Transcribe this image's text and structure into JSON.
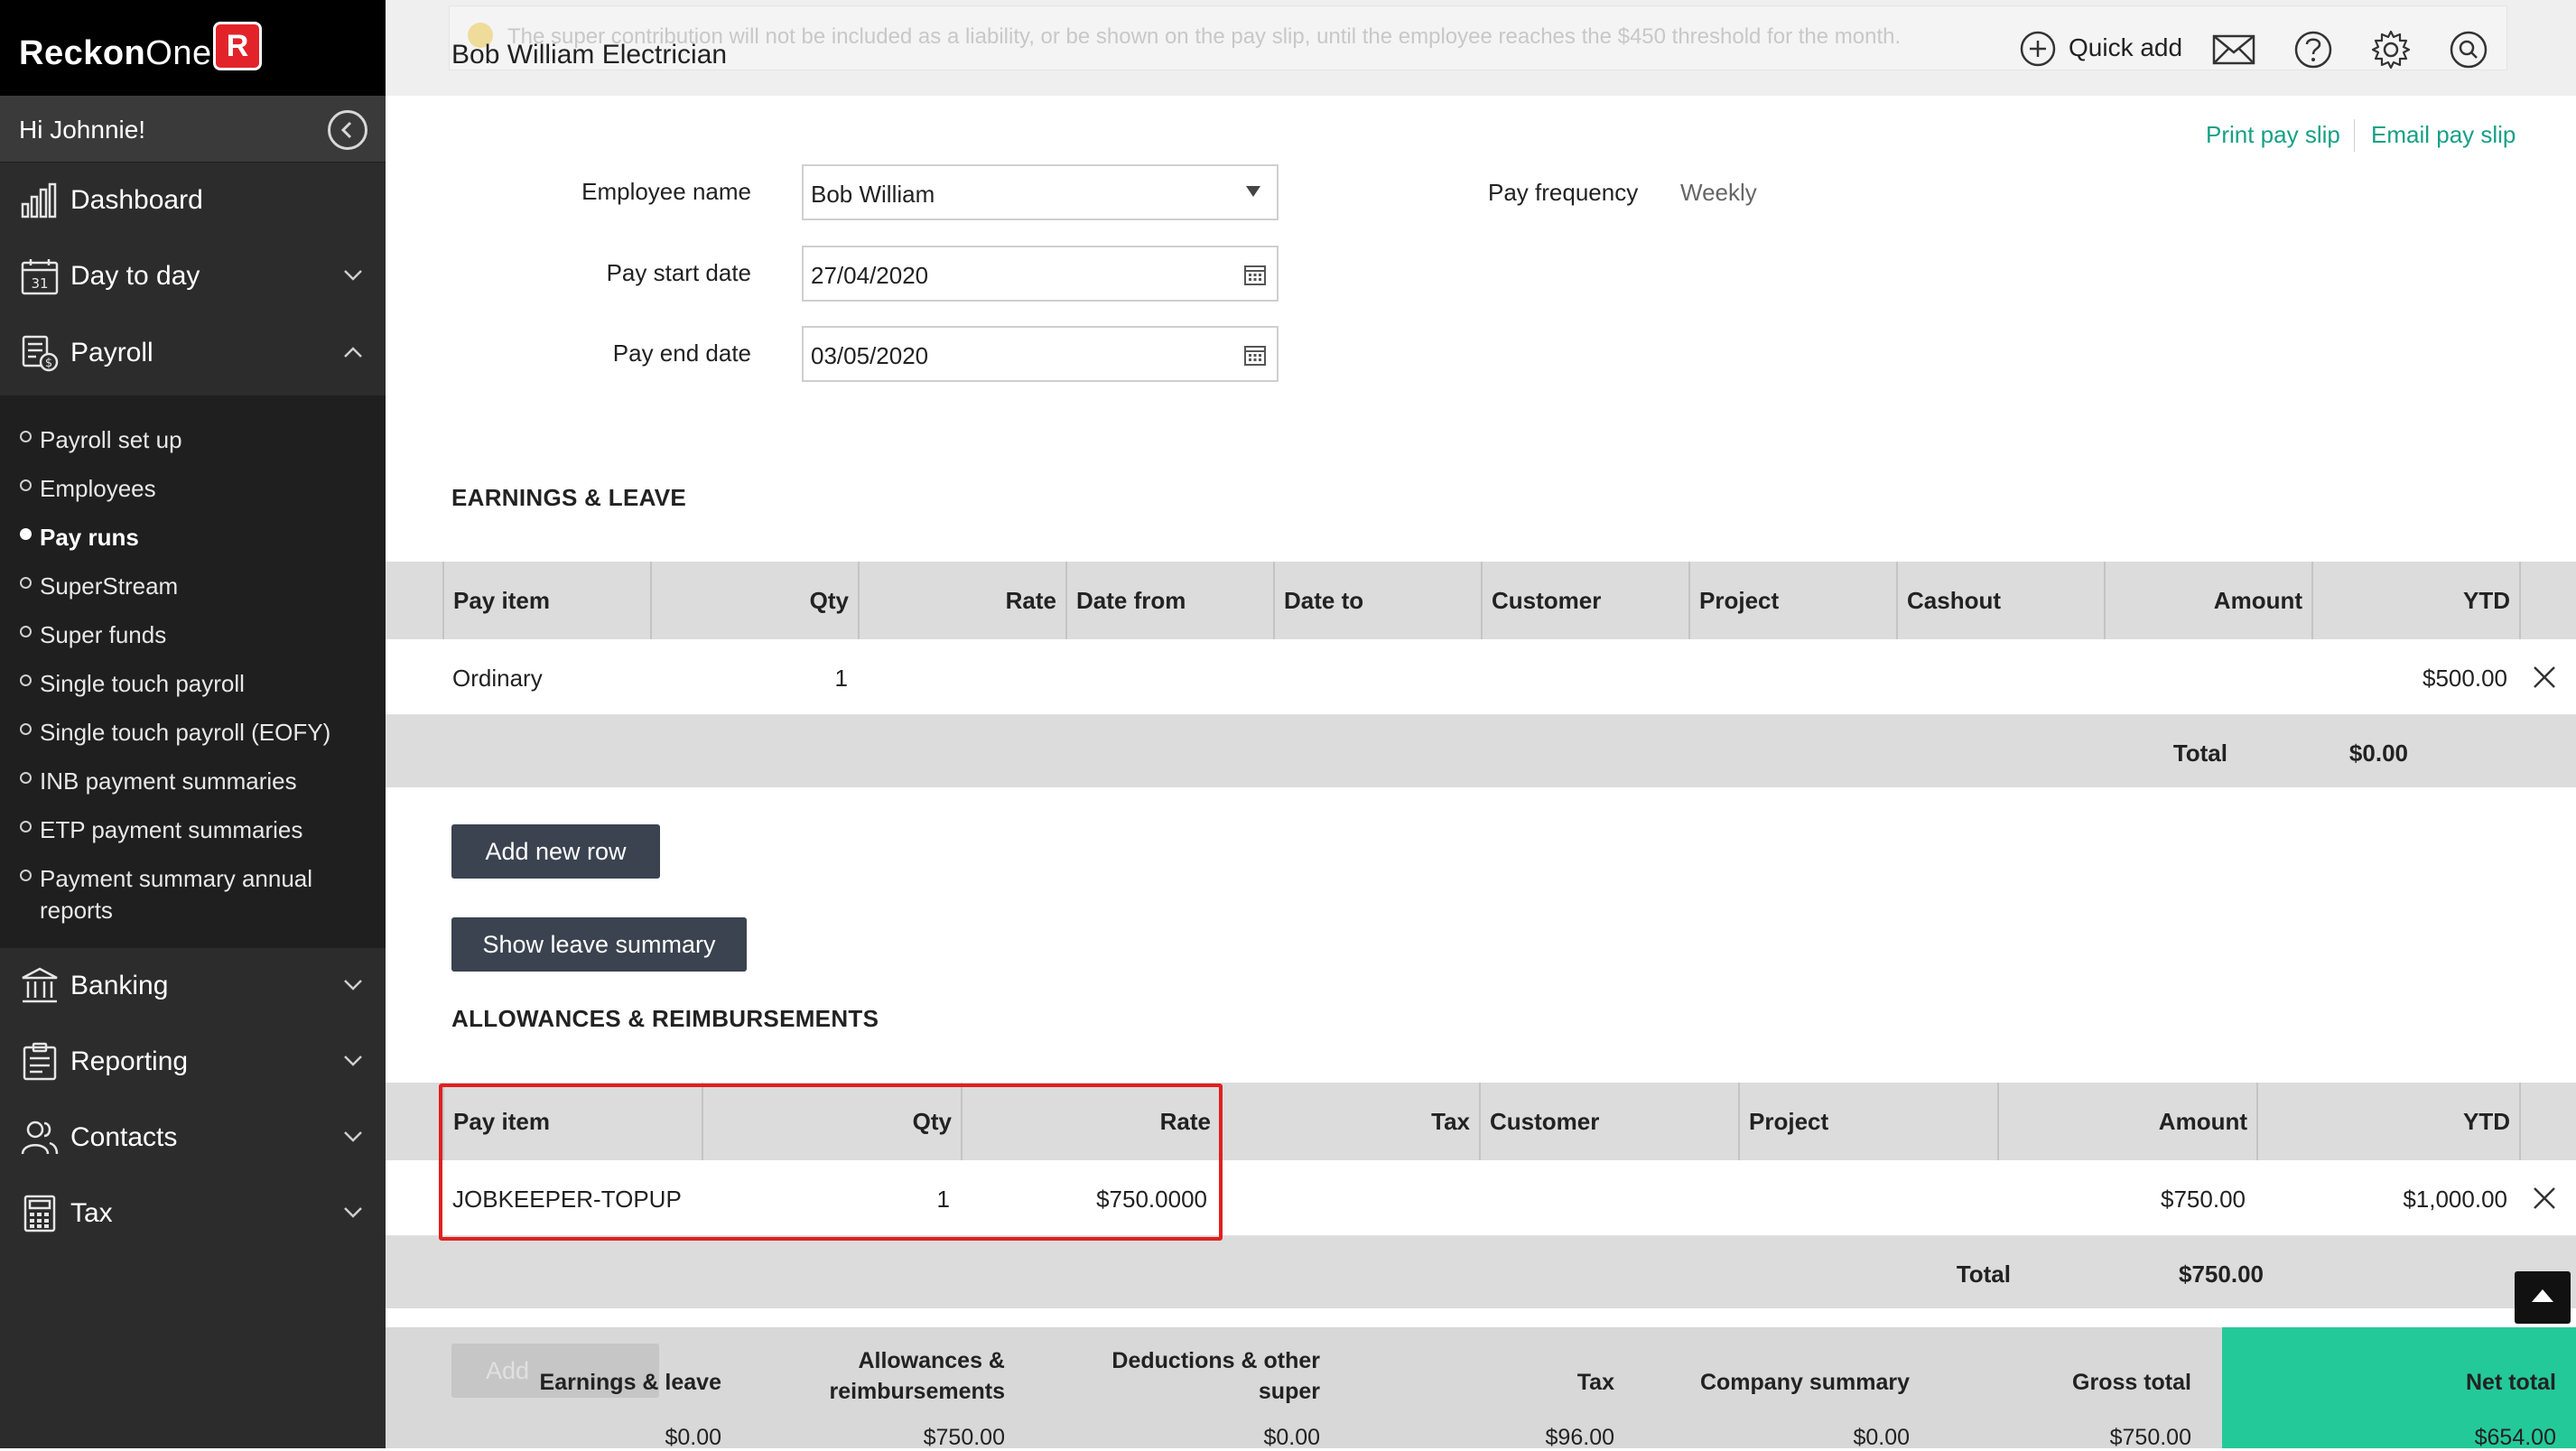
{
  "app": {
    "logo_text": "ReckonOne",
    "logo_badge": "R"
  },
  "sidebar": {
    "greeting": "Hi Johnnie!",
    "items": [
      {
        "label": "Dashboard",
        "icon": "bar-chart-icon"
      },
      {
        "label": "Day to day",
        "icon": "calendar-icon"
      },
      {
        "label": "Payroll",
        "icon": "payroll-icon"
      },
      {
        "label": "Banking",
        "icon": "bank-icon"
      },
      {
        "label": "Reporting",
        "icon": "report-icon"
      },
      {
        "label": "Contacts",
        "icon": "contacts-icon"
      },
      {
        "label": "Tax",
        "icon": "calculator-icon"
      }
    ],
    "payroll_sub": [
      {
        "label": "Payroll set up",
        "active": false
      },
      {
        "label": "Employees",
        "active": false
      },
      {
        "label": "Pay runs",
        "active": true
      },
      {
        "label": "SuperStream",
        "active": false
      },
      {
        "label": "Super funds",
        "active": false
      },
      {
        "label": "Single touch payroll",
        "active": false
      },
      {
        "label": "Single touch payroll (EOFY)",
        "active": false
      },
      {
        "label": "INB payment summaries",
        "active": false
      },
      {
        "label": "ETP payment summaries",
        "active": false
      },
      {
        "label": "Payment summary annual reports",
        "active": false
      }
    ]
  },
  "header": {
    "notice": "The super contribution will not be included as a liability, or be shown on the pay slip, until the employee reaches the $450 threshold for the month.",
    "title": "Bob William Electrician",
    "quick_add": "Quick add"
  },
  "actions": {
    "print": "Print pay slip",
    "email": "Email pay slip"
  },
  "form": {
    "employee_label": "Employee name",
    "employee_value": "Bob William",
    "start_label": "Pay start date",
    "start_value": "27/04/2020",
    "end_label": "Pay end date",
    "end_value": "03/05/2020",
    "frequency_label": "Pay frequency",
    "frequency_value": "Weekly"
  },
  "earnings": {
    "heading": "EARNINGS & LEAVE",
    "headers": [
      "Pay item",
      "Qty",
      "Rate",
      "Date from",
      "Date to",
      "Customer",
      "Project",
      "Cashout",
      "Amount",
      "YTD"
    ],
    "rows": [
      {
        "pay_item": "Ordinary",
        "qty": "1",
        "ytd": "$500.00"
      }
    ],
    "total_label": "Total",
    "total_value": "$0.00",
    "add_row": "Add new row",
    "leave_summary": "Show leave summary"
  },
  "allowances": {
    "heading": "ALLOWANCES & REIMBURSEMENTS",
    "headers": [
      "Pay item",
      "Qty",
      "Rate",
      "Tax",
      "Customer",
      "Project",
      "Amount",
      "YTD"
    ],
    "rows": [
      {
        "pay_item": "JOBKEEPER-TOPUP",
        "qty": "1",
        "rate": "$750.0000",
        "amount": "$750.00",
        "ytd": "$1,000.00"
      }
    ],
    "total_label": "Total",
    "total_value": "$750.00",
    "ghost_button": "Add"
  },
  "footer": {
    "columns": [
      {
        "label": "Earnings & leave",
        "value": "$0.00"
      },
      {
        "label": "Allowances & reimbursements",
        "value": "$750.00"
      },
      {
        "label": "Deductions & other super",
        "value": "$0.00"
      },
      {
        "label": "Tax",
        "value": "$96.00"
      },
      {
        "label": "Company summary",
        "value": "$0.00"
      },
      {
        "label": "Gross total",
        "value": "$750.00"
      },
      {
        "label": "Net total",
        "value": "$654.00"
      }
    ],
    "net_color": "#24c99a"
  },
  "colors": {
    "accent": "#16a086",
    "highlight": "#e0201f",
    "button": "#3b4350"
  }
}
